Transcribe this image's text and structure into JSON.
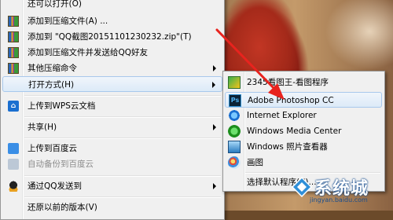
{
  "context_menu": {
    "items": [
      {
        "label": "还可以打开(O)",
        "icon": "none"
      },
      {
        "label": "添加到压缩文件(A) ...",
        "icon": "winrar-icon"
      },
      {
        "label": "添加到 \"QQ截图20151101230232.zip\"(T)",
        "icon": "winrar-icon"
      },
      {
        "label": "添加到压缩文件并发送给QQ好友",
        "icon": "winrar-icon"
      },
      {
        "label": "其他压缩命令",
        "icon": "winrar-icon",
        "submenu": true
      },
      {
        "label": "打开方式(H)",
        "icon": "none",
        "submenu": true
      },
      {
        "label": "上传到WPS云文档",
        "icon": "wps-cloud-icon"
      },
      {
        "label": "共享(H)",
        "icon": "none",
        "submenu": true
      },
      {
        "label": "上传到百度云",
        "icon": "baidu-cloud-icon"
      },
      {
        "label": "自动备份到百度云",
        "icon": "baidu-cloud-icon",
        "disabled": true
      },
      {
        "label": "通过QQ发送到",
        "icon": "qq-icon",
        "submenu": true
      },
      {
        "label": "还原以前的版本(V)",
        "icon": "none"
      }
    ]
  },
  "open_with_submenu": {
    "items": [
      {
        "label": "2345看图王-看图程序",
        "icon": "2345-viewer-icon"
      },
      {
        "label": "Adobe Photoshop CC",
        "icon": "photoshop-icon"
      },
      {
        "label": "Internet Explorer",
        "icon": "ie-icon"
      },
      {
        "label": "Windows Media Center",
        "icon": "media-center-icon"
      },
      {
        "label": "Windows 照片查看器",
        "icon": "photo-viewer-icon"
      },
      {
        "label": "画图",
        "icon": "paint-icon"
      },
      {
        "label": "选择默认程序(C)...",
        "icon": "none"
      }
    ]
  },
  "watermark": {
    "text": "系统城",
    "url": "jingyan.baidu.com"
  },
  "colors": {
    "menu_bg": "#f0f0f0",
    "hover_bg": "#dceaf8",
    "annotation_arrow": "#e8231e"
  }
}
